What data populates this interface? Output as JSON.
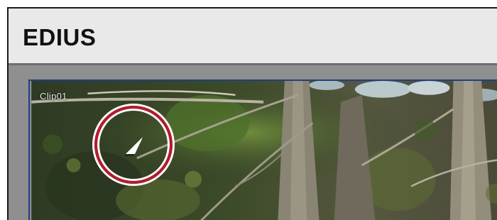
{
  "app": {
    "title": "EDIUS"
  },
  "clip": {
    "label": "Clip01",
    "play_icon": "play-triangle-icon"
  },
  "colors": {
    "highlight_ring": "#b51a2e",
    "clip_border": "#1e3f8a"
  }
}
